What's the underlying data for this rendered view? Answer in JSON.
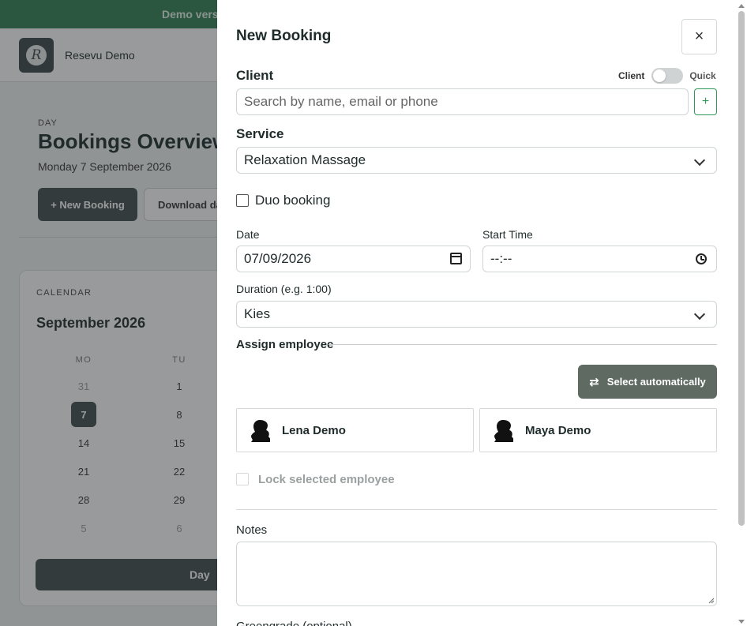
{
  "banner": {
    "text": "Demo vers"
  },
  "app": {
    "brand": "Resevu Demo",
    "logo_letter": "R"
  },
  "overview": {
    "eyebrow": "DAY",
    "title": "Bookings Overview",
    "date": "Monday 7 September 2026",
    "new_booking_label": "+ New Booking",
    "download_label": "Download da"
  },
  "calendar": {
    "eyebrow": "CALENDAR",
    "month": "September 2026",
    "weekdays": [
      "MO",
      "TU"
    ],
    "rows": [
      [
        "31",
        "1"
      ],
      [
        "7",
        "8"
      ],
      [
        "14",
        "15"
      ],
      [
        "21",
        "22"
      ],
      [
        "28",
        "29"
      ],
      [
        "5",
        "6"
      ]
    ],
    "selected_day": "7",
    "view_button": "Day"
  },
  "modal": {
    "title": "New Booking",
    "close_symbol": "×",
    "client": {
      "label": "Client",
      "toggle_left": "Client",
      "toggle_right": "Quick",
      "toggle_on": false,
      "search_placeholder": "Search by name, email or phone",
      "search_value": "",
      "add_symbol": "+"
    },
    "service": {
      "label": "Service",
      "selected": "Relaxation Massage"
    },
    "duo": {
      "label": "Duo booking",
      "checked": false
    },
    "date": {
      "label": "Date",
      "value": "07/09/2026"
    },
    "start_time": {
      "label": "Start Time",
      "value": "--:--"
    },
    "duration": {
      "label": "Duration (e.g. 1:00)",
      "selected": "Kies"
    },
    "assign": {
      "label": "Assign employee",
      "auto_button": "Select automatically",
      "employees": [
        {
          "name": "Lena Demo"
        },
        {
          "name": "Maya Demo"
        }
      ],
      "lock_label": "Lock selected employee"
    },
    "notes": {
      "label": "Notes",
      "value": ""
    },
    "cutoff_label": "Greengrade (optional)"
  },
  "icons": {
    "close": "close-icon",
    "plus": "plus-icon",
    "chevron": "chevron-down-icon",
    "calendar": "calendar-icon",
    "clock": "clock-icon",
    "swap": "swap-icon",
    "avatar": "avatar-silhouette-icon"
  },
  "colors": {
    "banner": "#2e7d4f",
    "primary_dark": "#3f4a4c",
    "auto_button": "#5f6b62",
    "accent_green": "#2e9a5a"
  }
}
